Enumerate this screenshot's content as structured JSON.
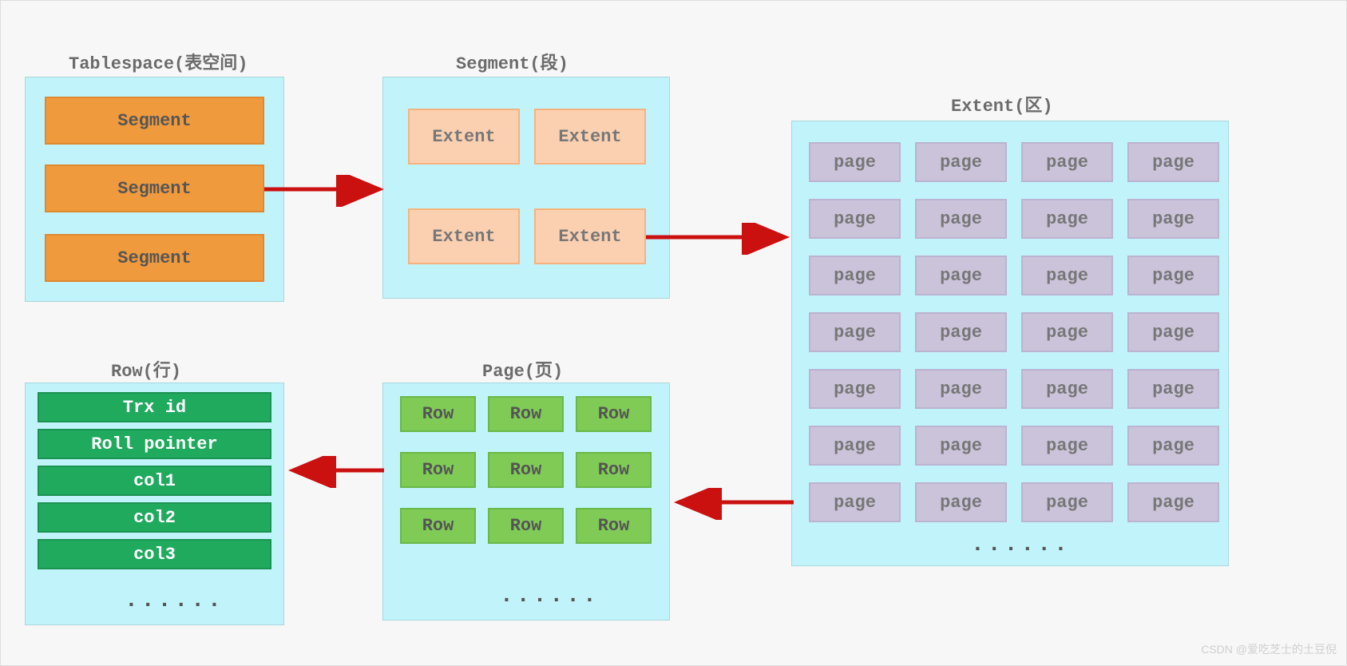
{
  "titles": {
    "tablespace": "Tablespace(表空间)",
    "segment": "Segment(段)",
    "extent": "Extent(区)",
    "page": "Page(页)",
    "row": "Row(行)"
  },
  "tablespace": {
    "items": [
      "Segment",
      "Segment",
      "Segment"
    ]
  },
  "segment": {
    "items": [
      "Extent",
      "Extent",
      "Extent",
      "Extent"
    ]
  },
  "extent": {
    "page_label": "page",
    "ellipsis": "......"
  },
  "page": {
    "row_label": "Row",
    "ellipsis": "......"
  },
  "row": {
    "items": [
      "Trx id",
      "Roll pointer",
      "col1",
      "col2",
      "col3"
    ],
    "ellipsis": "......"
  },
  "watermark": "CSDN @爱吃芝士的土豆倪"
}
